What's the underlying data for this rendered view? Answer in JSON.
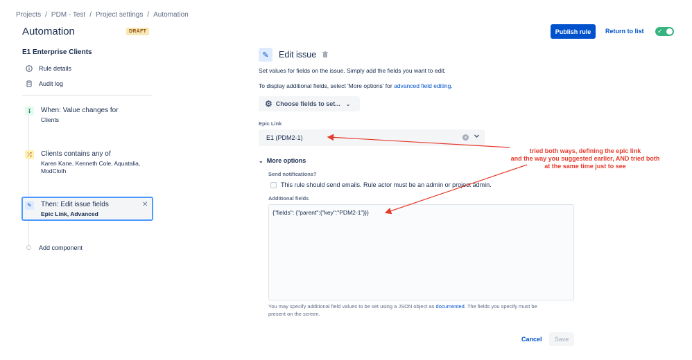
{
  "breadcrumb": [
    "Projects",
    "PDM - Test",
    "Project settings",
    "Automation"
  ],
  "breadcrumb_sep": "/",
  "header": {
    "title": "Automation",
    "badge": "DRAFT",
    "publish_label": "Publish rule",
    "return_label": "Return to list",
    "toggle_on": true
  },
  "sidebar": {
    "rule_name": "E1 Enterprise Clients",
    "items": [
      {
        "label": "Rule details",
        "icon": "info-icon"
      },
      {
        "label": "Audit log",
        "icon": "document-icon"
      }
    ],
    "components": [
      {
        "title": "When: Value changes for",
        "detail": "Clients",
        "icon": "trigger-icon"
      },
      {
        "title": "Clients contains any of",
        "detail": "Karen Kane, Kenneth Cole, Aquatalia, ModCloth",
        "icon": "shuffle-icon"
      },
      {
        "title": "Then: Edit issue fields",
        "detail": "Epic Link, Advanced",
        "icon": "pencil-icon"
      }
    ],
    "add_component": "Add component"
  },
  "main": {
    "title": "Edit issue",
    "desc1": "Set values for fields on the issue. Simply add the fields you want to edit.",
    "desc2_prefix": "To display additional fields, select 'More options' for ",
    "desc2_link": "advanced field editing",
    "desc2_suffix": ".",
    "choose_fields": "Choose fields to set...",
    "epic_label": "Epic Link",
    "epic_value": "E1 (PDM2-1)",
    "more_options": "More options",
    "send_notifications_label": "Send notifications?",
    "send_notifications_text": "This rule should send emails. Rule actor must be an admin or project admin.",
    "additional_fields_label": "Additional fields",
    "additional_fields_value": "{\"fields\": {\"parent\":{\"key\":\"PDM2-1\"}}}",
    "help_prefix": "You may specify additional field values to be set using a JSON object as ",
    "help_link": "documented",
    "help_suffix": ". The fields you specify must be",
    "help_line2": "present on the screen.",
    "cancel_label": "Cancel",
    "save_label": "Save"
  },
  "annotation": {
    "lines": [
      "tried both ways, defining the epic link",
      "and the way you suggested earlier, AND tried both",
      "at the same time just to see"
    ],
    "color": "#e53b2c"
  },
  "colors": {
    "primary": "#0052cc",
    "toggle": "#36b37e",
    "selection": "#4c9aff"
  }
}
